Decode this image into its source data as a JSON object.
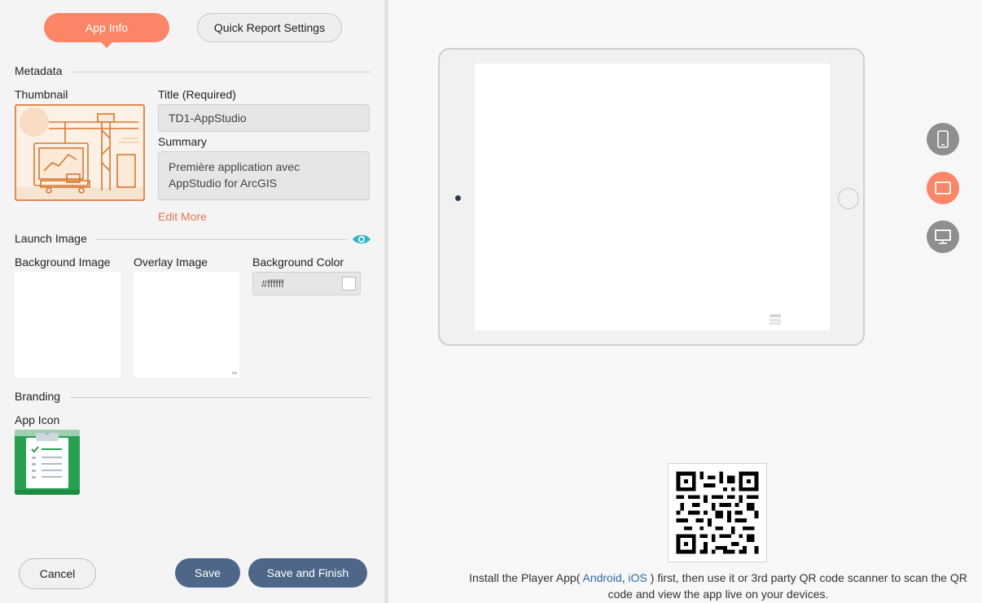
{
  "tabs": {
    "app_info": "App Info",
    "quick_report": "Quick Report Settings"
  },
  "metadata": {
    "section_title": "Metadata",
    "thumbnail_label": "Thumbnail",
    "title_label": "Title (Required)",
    "title_value": "TD1-AppStudio",
    "summary_label": "Summary",
    "summary_line1": "Première application avec",
    "summary_line2": "AppStudio for ArcGIS",
    "edit_more": "Edit More"
  },
  "launch_image": {
    "section_title": "Launch Image",
    "background_image_label": "Background Image",
    "overlay_image_label": "Overlay Image",
    "background_color_label": "Background Color",
    "background_color_value": "#ffffff"
  },
  "branding": {
    "section_title": "Branding",
    "app_icon_label": "App Icon"
  },
  "buttons": {
    "cancel": "Cancel",
    "save": "Save",
    "save_and_finish": "Save and Finish"
  },
  "install": {
    "prefix": "Install the Player App( ",
    "android": "Android",
    "sep": ", ",
    "ios": "iOS",
    "suffix": " ) first, then use it or 3rd party QR code scanner to scan the QR code and view the app live on your devices."
  },
  "device_buttons": [
    {
      "name": "phone-icon",
      "active": false
    },
    {
      "name": "tablet-icon",
      "active": true
    },
    {
      "name": "desktop-icon",
      "active": false
    }
  ],
  "colors": {
    "accent": "#fb8667",
    "primary_button": "#4e6788",
    "device_inactive": "#8e8e8e",
    "link": "#2e6aa5",
    "edit_more": "#e8765a",
    "eye_icon": "#2fb5c6"
  }
}
